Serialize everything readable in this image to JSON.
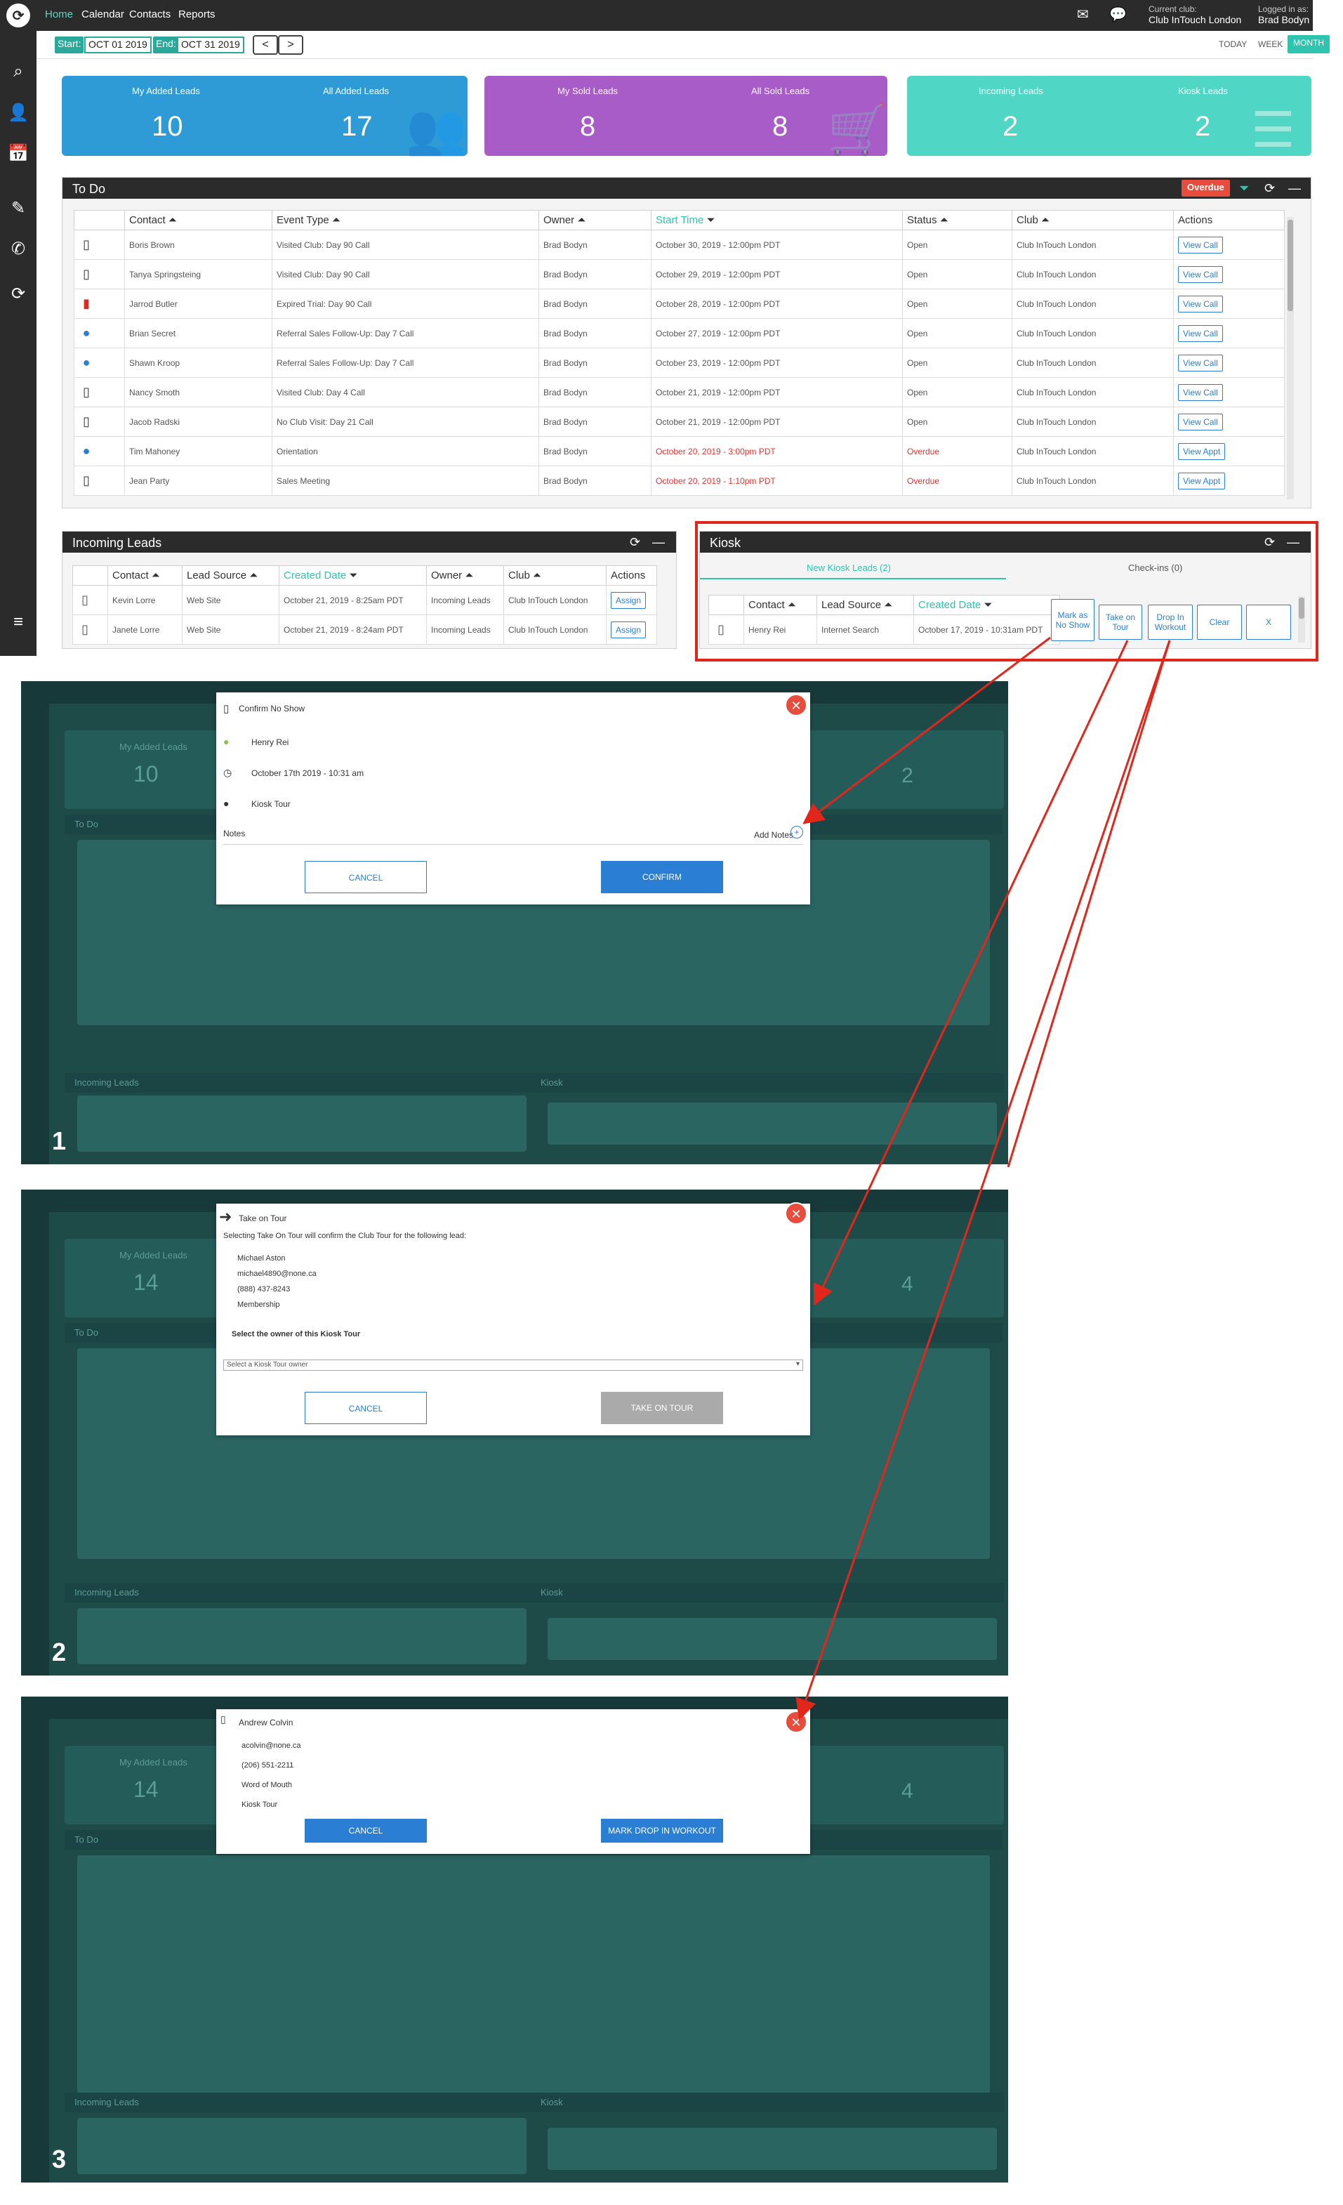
{
  "nav": {
    "home": "Home",
    "calendar": "Calendar",
    "contacts": "Contacts",
    "reports": "Reports"
  },
  "header": {
    "current_club_label": "Current club:",
    "current_club": "Club InTouch London",
    "logged_label": "Logged in as:",
    "logged_user": "Brad Bodyn"
  },
  "dates": {
    "start_label": "Start:",
    "start": "OCT 01 2019",
    "end_label": "End:",
    "end": "OCT 31 2019",
    "prev": "<",
    "next": ">",
    "today": "TODAY",
    "week": "WEEK",
    "month": "MONTH"
  },
  "stats": [
    {
      "l1": "My Added Leads",
      "v1": "10",
      "l2": "All Added Leads",
      "v2": "17",
      "color": "#2e9bd6"
    },
    {
      "l1": "My Sold Leads",
      "v1": "8",
      "l2": "All Sold Leads",
      "v2": "8",
      "color": "#a85cc7"
    },
    {
      "l1": "Incoming Leads",
      "v1": "2",
      "l2": "Kiosk Leads",
      "v2": "2",
      "color": "#4fd6c4"
    }
  ],
  "todo": {
    "title": "To Do",
    "overdue": "Overdue",
    "headers": [
      "Contact",
      "Event Type",
      "Owner",
      "Start Time",
      "Status",
      "Club",
      "Actions"
    ],
    "rows": [
      [
        "Boris Brown",
        "Visited Club: Day 90 Call",
        "Brad Bodyn",
        "October 30, 2019 - 12:00pm PDT",
        "Open",
        "Club InTouch London",
        "View Call"
      ],
      [
        "Tanya Springsteing",
        "Visited Club: Day 90 Call",
        "Brad Bodyn",
        "October 29, 2019 - 12:00pm PDT",
        "Open",
        "Club InTouch London",
        "View Call"
      ],
      [
        "Jarrod Butler",
        "Expired Trial: Day 90 Call",
        "Brad Bodyn",
        "October 28, 2019 - 12:00pm PDT",
        "Open",
        "Club InTouch London",
        "View Call"
      ],
      [
        "Brian Secret",
        "Referral Sales Follow-Up: Day 7 Call",
        "Brad Bodyn",
        "October 27, 2019 - 12:00pm PDT",
        "Open",
        "Club InTouch London",
        "View Call"
      ],
      [
        "Shawn Kroop",
        "Referral Sales Follow-Up: Day 7 Call",
        "Brad Bodyn",
        "October 23, 2019 - 12:00pm PDT",
        "Open",
        "Club InTouch London",
        "View Call"
      ],
      [
        "Nancy Smoth",
        "Visited Club: Day 4 Call",
        "Brad Bodyn",
        "October 21, 2019 - 12:00pm PDT",
        "Open",
        "Club InTouch London",
        "View Call"
      ],
      [
        "Jacob Radski",
        "No Club Visit: Day 21 Call",
        "Brad Bodyn",
        "October 21, 2019 - 12:00pm PDT",
        "Open",
        "Club InTouch London",
        "View Call"
      ],
      [
        "Tim Mahoney",
        "Orientation",
        "Brad Bodyn",
        "October 20, 2019 - 3:00pm PDT",
        "Overdue",
        "Club InTouch London",
        "View Appt"
      ],
      [
        "Jean Party",
        "Sales Meeting",
        "Brad Bodyn",
        "October 20, 2019 - 1:10pm PDT",
        "Overdue",
        "Club InTouch London",
        "View Appt"
      ]
    ]
  },
  "incoming": {
    "title": "Incoming Leads",
    "headers": [
      "Contact",
      "Lead Source",
      "Created Date",
      "Owner",
      "Club",
      "Actions"
    ],
    "rows": [
      [
        "Kevin Lorre",
        "Web Site",
        "October 21, 2019 - 8:25am PDT",
        "Incoming Leads",
        "Club InTouch London",
        "Assign"
      ],
      [
        "Janete Lorre",
        "Web Site",
        "October 21, 2019 - 8:24am PDT",
        "Incoming Leads",
        "Club InTouch London",
        "Assign"
      ]
    ]
  },
  "kiosk": {
    "title": "Kiosk",
    "tab_new": "New Kiosk Leads (2)",
    "tab_checkins": "Check-ins (0)",
    "headers": [
      "Contact",
      "Lead Source",
      "Created Date"
    ],
    "row": [
      "Henry Rei",
      "Internet Search",
      "October 17, 2019 - 10:31am PDT"
    ],
    "actions": {
      "no_show": "Mark as No Show",
      "tour": "Take on Tour",
      "drop": "Drop In Workout",
      "clear": "Clear",
      "x": "X"
    }
  },
  "shot1": {
    "num": "1",
    "title": "Confirm No Show",
    "name": "Henry Rei",
    "time": "October 17th 2019 - 10:31 am",
    "type": "Kiosk Tour",
    "notes": "Notes",
    "add_notes": "Add Notes",
    "cancel": "CANCEL",
    "confirm": "CONFIRM"
  },
  "shot2": {
    "num": "2",
    "title": "Take on Tour",
    "desc": "Selecting Take On Tour will confirm the Club Tour for the following lead:",
    "name": "Michael Aston",
    "email": "michael4890@none.ca",
    "phone": "(888) 437-8243",
    "type": "Membership",
    "owner_label": "Select the owner of this Kiosk Tour",
    "select_placeholder": "Select a Kiosk Tour owner",
    "cancel": "CANCEL",
    "action": "TAKE ON TOUR"
  },
  "shot3": {
    "num": "3",
    "name": "Andrew Colvin",
    "email": "acolvin@none.ca",
    "phone": "(206) 551-2211",
    "source": "Word of Mouth",
    "type": "Kiosk Tour",
    "cancel": "CANCEL",
    "action": "MARK DROP IN WORKOUT"
  },
  "ghost": {
    "my_added": "My Added Leads",
    "todo": "To Do",
    "incoming": "Incoming Leads",
    "kiosk": "Kiosk",
    "num1": "10",
    "num2": "14",
    "num_right": "2",
    "num_right2": "4"
  }
}
